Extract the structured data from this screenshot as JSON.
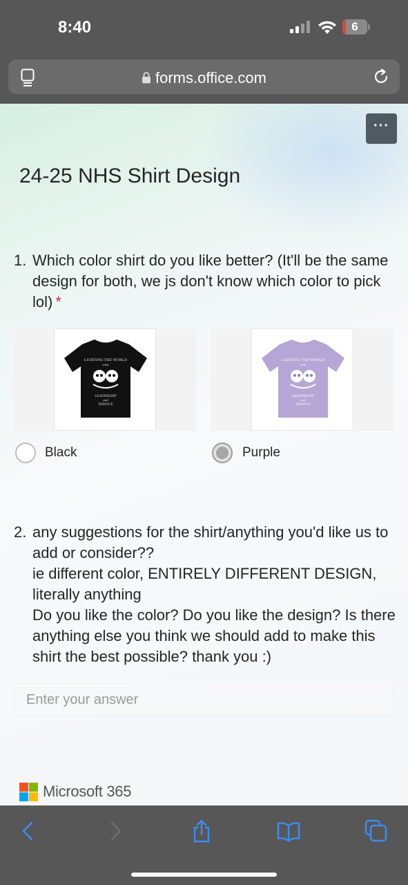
{
  "status_bar": {
    "time": "8:40",
    "battery": "6",
    "icons": [
      "cellular-signal-icon",
      "wifi-icon",
      "battery-icon"
    ]
  },
  "browser": {
    "url": "forms.office.com",
    "icons": [
      "tabs-icon",
      "lock-icon",
      "reload-icon"
    ]
  },
  "form": {
    "more_label": "···",
    "title": "24-25 NHS Shirt Design",
    "questions": [
      {
        "number": "1.",
        "text": "Which color shirt do you like better? (It'll be the same design for both, we js don't know which color to pick lol)",
        "required_mark": "*",
        "options": [
          {
            "label": "Black",
            "selected": false,
            "shirt_color": "#111111"
          },
          {
            "label": "Purple",
            "selected": true,
            "shirt_color": "#b5a6d6"
          }
        ]
      },
      {
        "number": "2.",
        "text_lines": [
          "any suggestions for the shirt/anything you'd like us to add or consider??",
          "ie different color, ENTIRELY DIFFERENT DESIGN, literally anything",
          "Do you like the color? Do you like the design? Is there anything else you think we should add to make this shirt the best possible? thank you :)"
        ],
        "placeholder": "Enter your answer"
      }
    ]
  },
  "footer": {
    "brand": "Microsoft 365",
    "logo_colors": [
      "#f25022",
      "#7fba00",
      "#00a4ef",
      "#ffb900"
    ]
  },
  "toolbar": {
    "icons": [
      "back-icon",
      "forward-icon",
      "share-icon",
      "bookmarks-icon",
      "tabs-overview-icon"
    ],
    "accent": "#3a8ef6"
  }
}
